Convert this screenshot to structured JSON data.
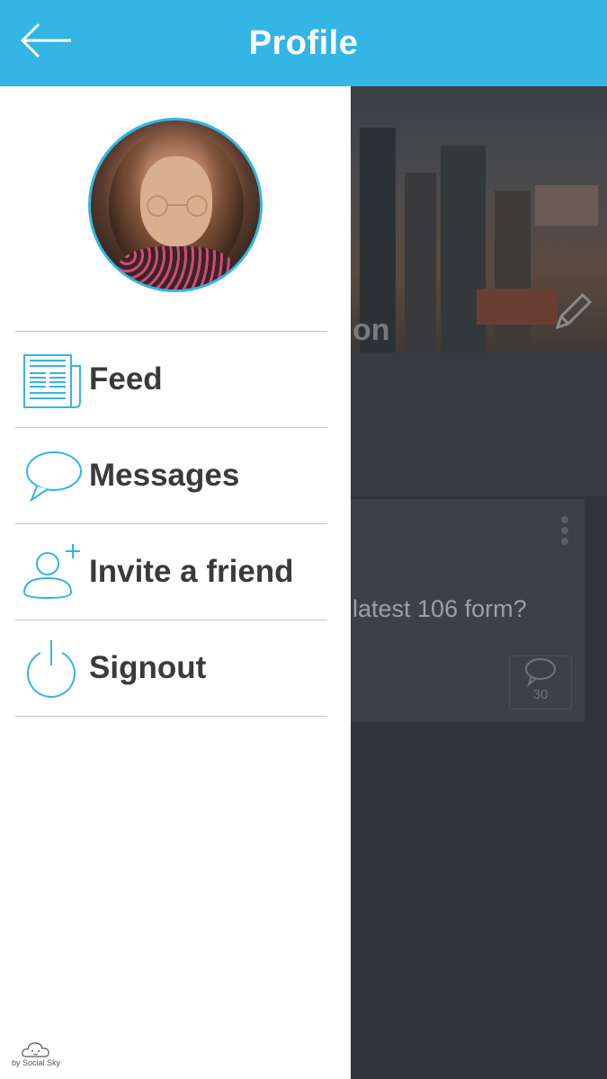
{
  "header": {
    "title": "Profile",
    "back_icon": "arrow-left-icon",
    "color": "#33b5e5"
  },
  "drawer": {
    "menu": [
      {
        "label": "Feed",
        "icon": "newspaper-icon"
      },
      {
        "label": "Messages",
        "icon": "chat-bubble-icon"
      },
      {
        "label": "Invite a friend",
        "icon": "add-user-icon"
      },
      {
        "label": "Signout",
        "icon": "power-icon"
      }
    ],
    "brand": "by Social Sky"
  },
  "background": {
    "cover_text_fragment": "on",
    "post_text_fragment": "latest 106 form?",
    "comment_count": "30"
  }
}
